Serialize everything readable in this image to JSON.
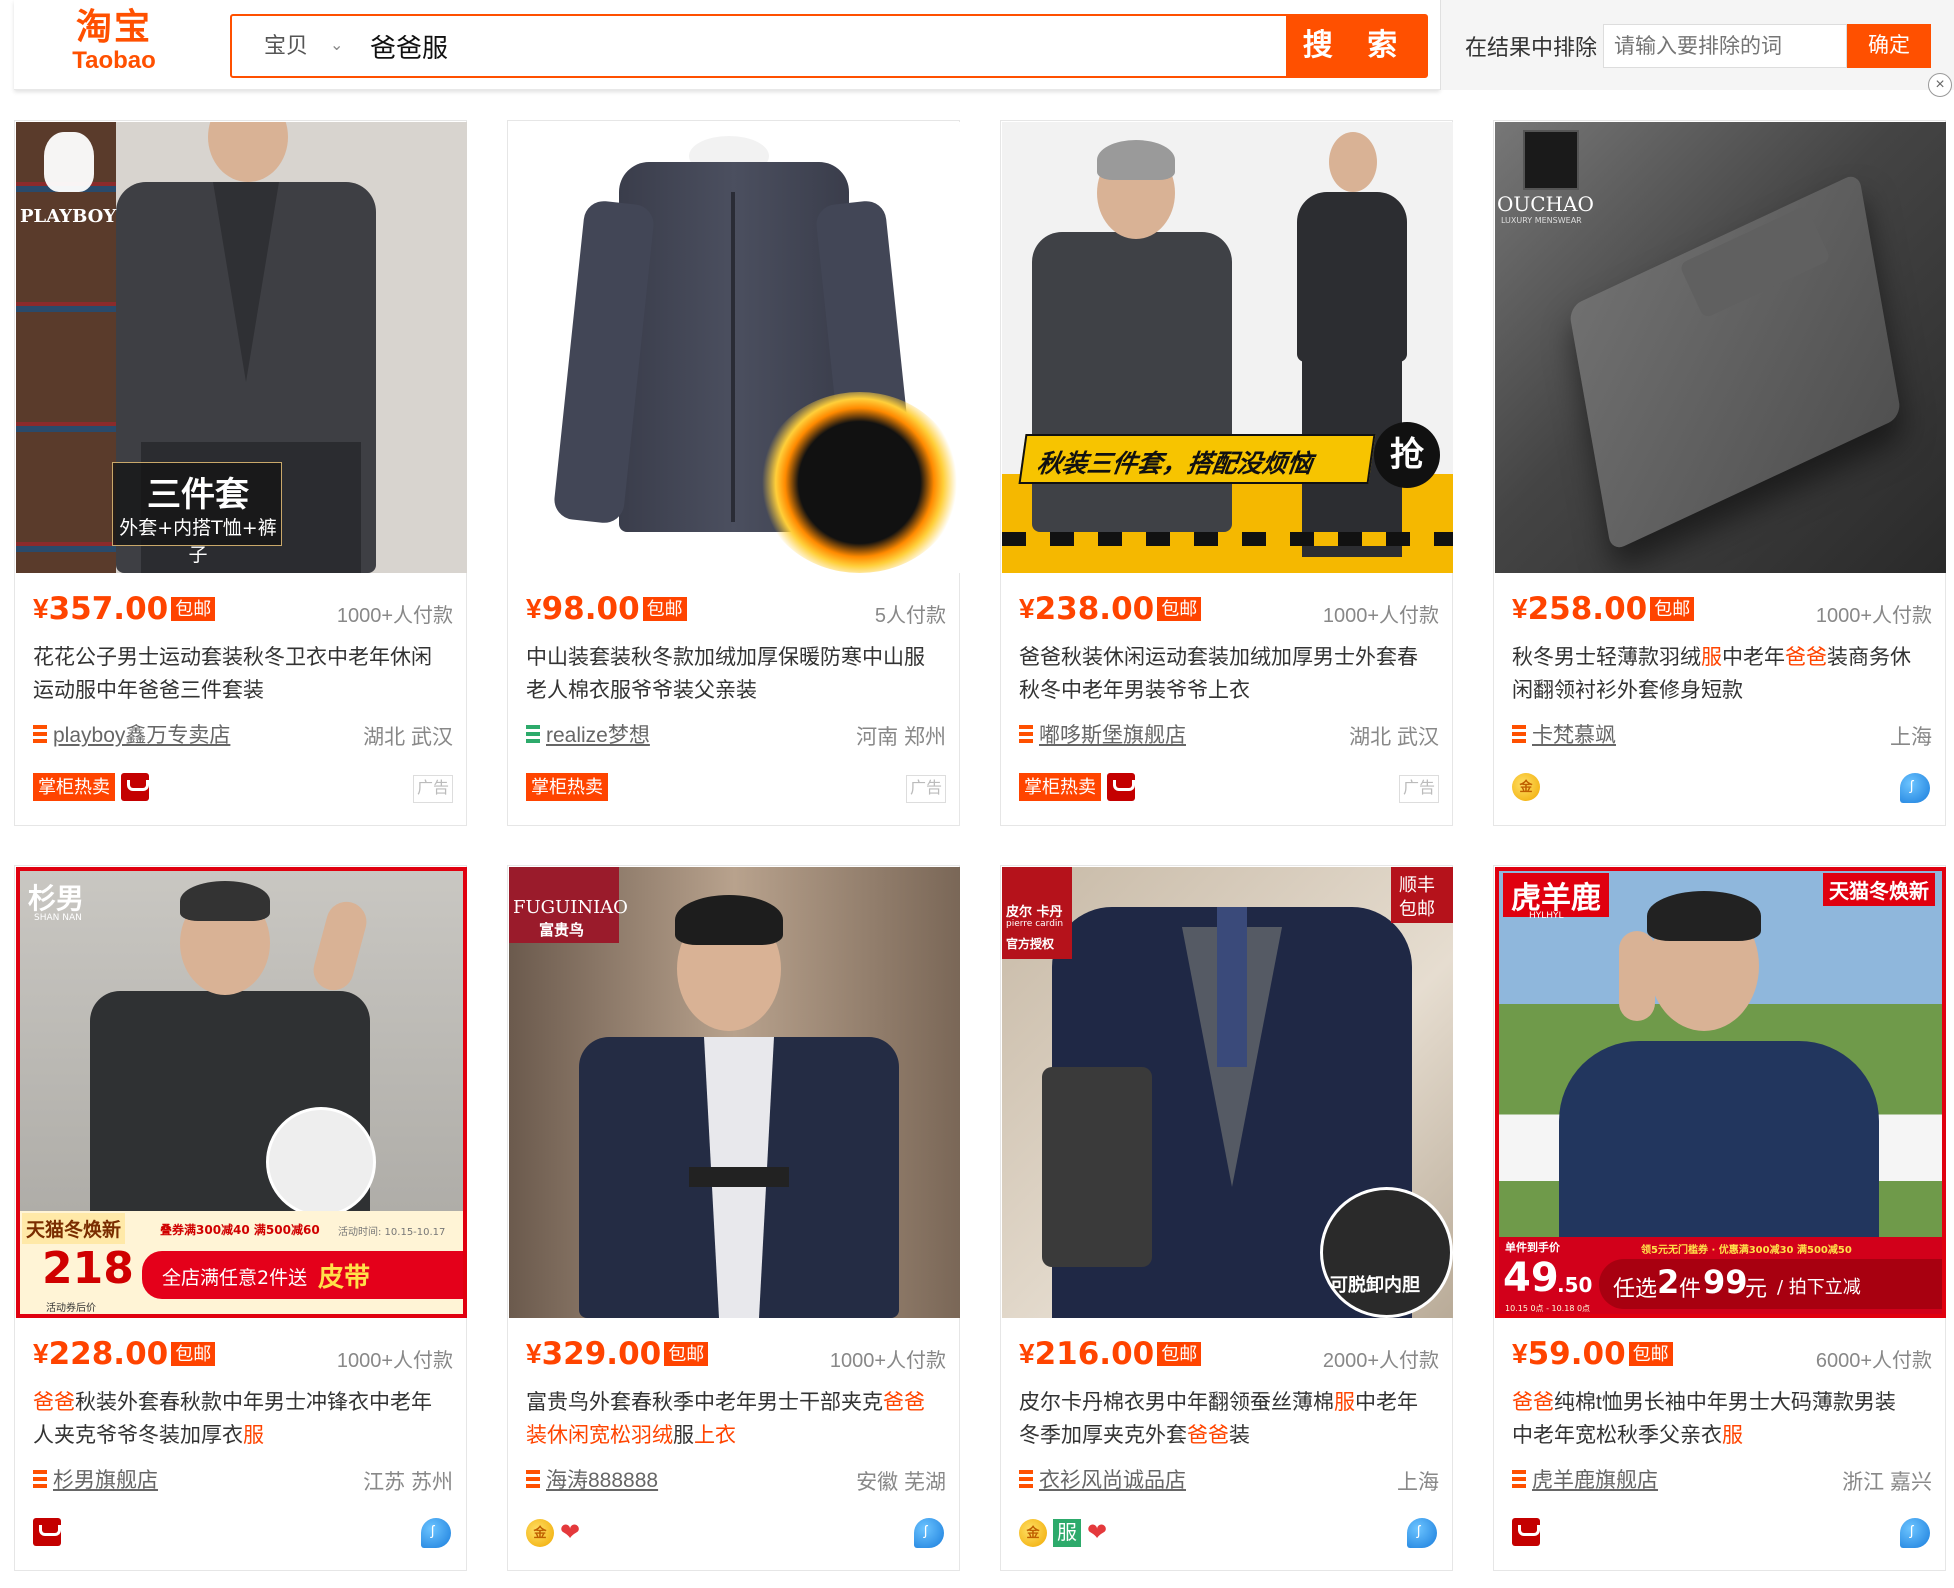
{
  "logo": {
    "cn": "淘宝",
    "en": "Taobao"
  },
  "search": {
    "scope": "宝贝",
    "query": "爸爸服",
    "button": "搜 索"
  },
  "exclude": {
    "label": "在结果中排除",
    "placeholder": "请输入要排除的词",
    "button": "确定"
  },
  "close_icon": "×",
  "products": [
    {
      "price": "357.00",
      "baoyou": "包邮",
      "paid": "1000+人付款",
      "title": [
        "花花公子男士运动套装秋冬卫衣中老年休闲",
        "运动服中年爸爸三件套装"
      ],
      "shop": "playboy鑫万专卖店",
      "location": "湖北 武汉",
      "badges": [
        "掌柜热卖",
        "tmall"
      ],
      "ad": "广告",
      "image": {
        "brand": "PLAYBOY",
        "caption1": "三件套",
        "caption2": "外套+内搭T恤+裤子"
      }
    },
    {
      "price": "98.00",
      "baoyou": "包邮",
      "paid": "5人付款",
      "title": [
        "中山装套装秋冬款加绒加厚保暖防寒中山服",
        "老人棉衣服爷爷装父亲装"
      ],
      "shop": "realize梦想",
      "location": "河南 郑州",
      "badges": [
        "掌柜热卖"
      ],
      "ad": "广告",
      "image": {}
    },
    {
      "price": "238.00",
      "baoyou": "包邮",
      "paid": "1000+人付款",
      "title": [
        "爸爸秋装休闲运动套装加绒加厚男士外套春",
        "秋冬中老年男装爷爷上衣"
      ],
      "shop": "嘟哆斯堡旗舰店",
      "location": "湖北 武汉",
      "badges": [
        "掌柜热卖",
        "tmall"
      ],
      "ad": "广告",
      "image": {
        "banner": "秋装三件套，搭配没烦恼",
        "grab": "抢"
      }
    },
    {
      "price": "258.00",
      "baoyou": "包邮",
      "paid": "1000+人付款",
      "title": [
        "秋冬男士轻薄款羽绒|服|中老年|爸爸|装商务休",
        "闲翻领衬衫外套修身短款"
      ],
      "shop": "卡梵慕飒",
      "location": "上海",
      "badges": [
        "gold"
      ],
      "ad": "",
      "image": {
        "brand": "OUCHAO",
        "sub": "LUXURY MENSWEAR"
      }
    },
    {
      "price": "228.00",
      "baoyou": "包邮",
      "paid": "1000+人付款",
      "title": [
        "|爸爸|秋装外套春秋款中年男士冲锋衣中老年",
        "人夹克爷爷冬装加厚衣|服|"
      ],
      "shop": "杉男旗舰店",
      "location": "江苏 苏州",
      "badges": [
        "tmall"
      ],
      "ad": "",
      "image": {
        "brand": "杉男",
        "brand_en": "SHAN NAN",
        "promo1": "天猫冬焕新",
        "promo_price": "218",
        "promo_sub": "活动券后价",
        "coupon": "叠券满300减40 满500减60",
        "period": "活动时间: 10.15-10.17",
        "promo2": "全店满任意2件送",
        "promo3": "皮带"
      }
    },
    {
      "price": "329.00",
      "baoyou": "包邮",
      "paid": "1000+人付款",
      "title": [
        "富贵鸟外套春秋季中老年男士干部夹克|爸爸",
        "|装休闲宽松羽绒|服|上衣"
      ],
      "shop": "海涛888888",
      "location": "安徽 芜湖",
      "badges": [
        "gold",
        "heart"
      ],
      "ad": "",
      "image": {
        "brand": "FUGUINIAO",
        "brand_cn": "富贵鸟"
      }
    },
    {
      "price": "216.00",
      "baoyou": "包邮",
      "paid": "2000+人付款",
      "title": [
        "皮尔卡丹棉衣男中年翻领蚕丝薄棉|服|中老年",
        "冬季加厚夹克外套|爸爸|装"
      ],
      "shop": "衣衫风尚诚品店",
      "location": "上海",
      "badges": [
        "gold",
        "fu",
        "heart"
      ],
      "ad": "",
      "image": {
        "brand": "皮尔 卡丹",
        "brand_en": "pierre cardin",
        "auth": "官方授权",
        "sf1": "顺丰",
        "sf2": "包邮",
        "detach": "可脱卸内胆"
      }
    },
    {
      "price": "59.00",
      "baoyou": "包邮",
      "paid": "6000+人付款",
      "title": [
        "|爸爸|纯棉t恤男长袖中年男士大码薄款男装",
        "中老年宽松秋季父亲衣|服|"
      ],
      "shop": "虎羊鹿旗舰店",
      "location": "浙江 嘉兴",
      "badges": [
        "tmall"
      ],
      "ad": "",
      "image": {
        "brand": "虎羊鹿",
        "brand_en": "HYLHYL",
        "promo1": "天猫冬焕新",
        "single": "单件到手价",
        "price": "49",
        "price_dec": ".50",
        "coupon": "领5元无门槛券 · 优惠满300减30 满500减50",
        "deal": "任选",
        "deal2": "2",
        "deal3": "件",
        "deal4": "99",
        "deal5": "元",
        "deal6": "/ 拍下立减",
        "period": "10.15 0点 - 10.18 0点"
      }
    }
  ],
  "colors": {
    "accent": "#ff5000",
    "price": "#ff4400"
  }
}
